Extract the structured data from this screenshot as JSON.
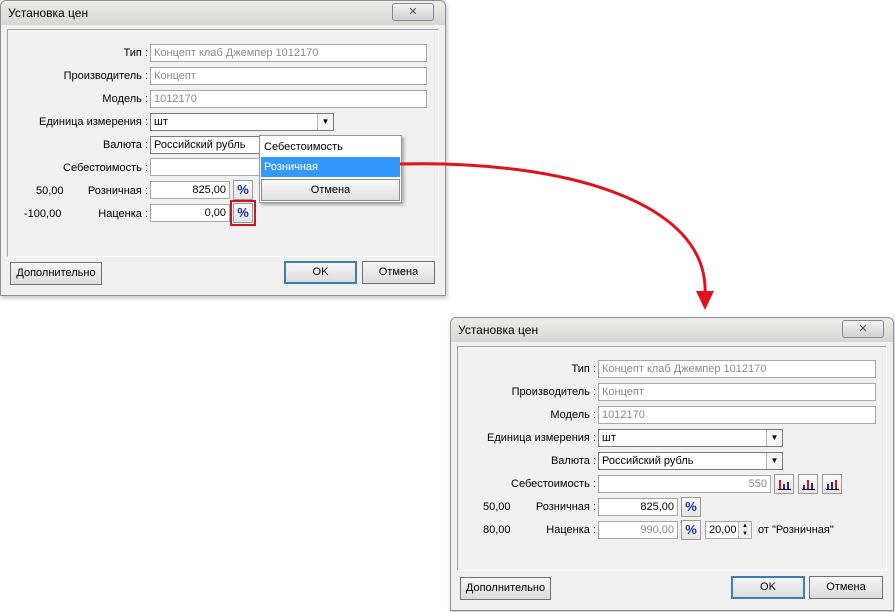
{
  "dialog_title": "Установка цен",
  "close_label": "✕",
  "labels": {
    "type": "Тип :",
    "manufacturer": "Производитель :",
    "model": "Модель :",
    "unit": "Единица измерения :",
    "currency": "Валюта :",
    "cost": "Себестоимость :",
    "retail": "Розничная :",
    "markup": "Наценка :"
  },
  "percent_label": "%",
  "buttons": {
    "advanced": "Дополнительно",
    "ok": "OK",
    "cancel": "Отмена"
  },
  "window1": {
    "type": "Концепт клаб Джемпер 1012170",
    "manufacturer": "Концепт",
    "model": "1012170",
    "unit": "шт",
    "currency": "Российский рубль",
    "cost": "",
    "retail_pct": "50,00",
    "retail": "825,00",
    "markup_pct": "-100,00",
    "markup": "0,00",
    "menu": {
      "items": [
        "Себестоимость",
        "Розничная"
      ],
      "selected": 1,
      "cancel": "Отмена"
    }
  },
  "window2": {
    "type": "Концепт клаб Джемпер 1012170",
    "manufacturer": "Концепт",
    "model": "1012170",
    "unit": "шт",
    "currency": "Российский рубль",
    "cost": "550",
    "retail_pct": "50,00",
    "retail": "825,00",
    "markup_pct": "80,00",
    "markup": "990,00",
    "markup_spin": "20,00",
    "markup_from": "от \"Розничная\""
  },
  "colors": {
    "accent": "#1a2fa8",
    "highlight": "#d4141c",
    "menu_selected": "#3399ff",
    "arrow": "#e0121b"
  },
  "icons": [
    "close-icon",
    "dropdown-arrow-icon",
    "percent-icon",
    "chart-icon",
    "arrow-icon"
  ]
}
